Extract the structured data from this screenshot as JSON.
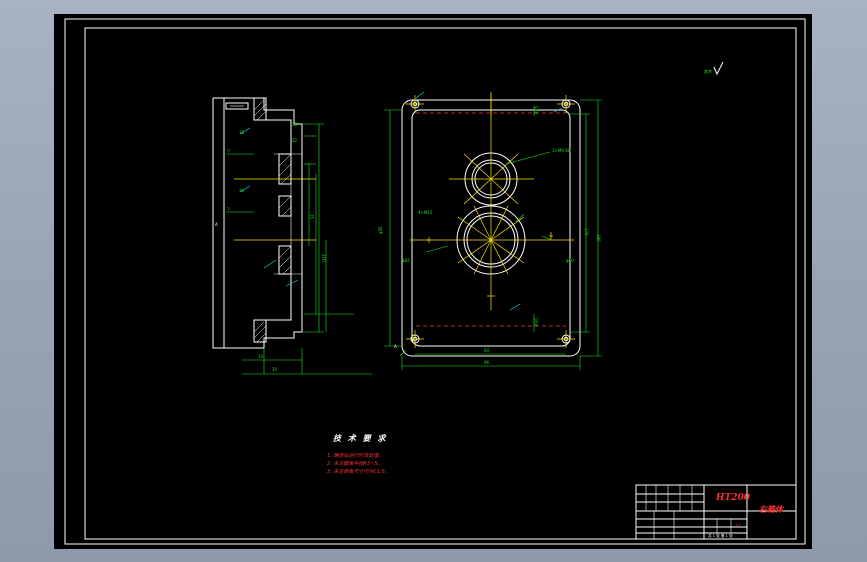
{
  "technical_requirements": {
    "title": "技 术 要 求",
    "items": [
      "1. 铸造后进行时效处理。",
      "2. 未注圆角半径R3~5。",
      "3. 未注倒角尺寸均为C1.5。"
    ]
  },
  "title_block": {
    "material": "HT200",
    "part_name": "右箱体",
    "sheet_info": "共 1 张  第 1 张",
    "scale": "1:1"
  },
  "surface_finish_note": "其余",
  "front_view_dims": [
    "R15",
    "R10",
    "172",
    "186",
    "φ42",
    "φ56",
    "φ40",
    "96",
    "60"
  ],
  "side_view_dims": [
    "10",
    "35",
    "16",
    "30",
    "75",
    "110",
    "28",
    "22"
  ],
  "front_view_hole_notes": [
    "4×M12",
    "3×M6-6H"
  ]
}
